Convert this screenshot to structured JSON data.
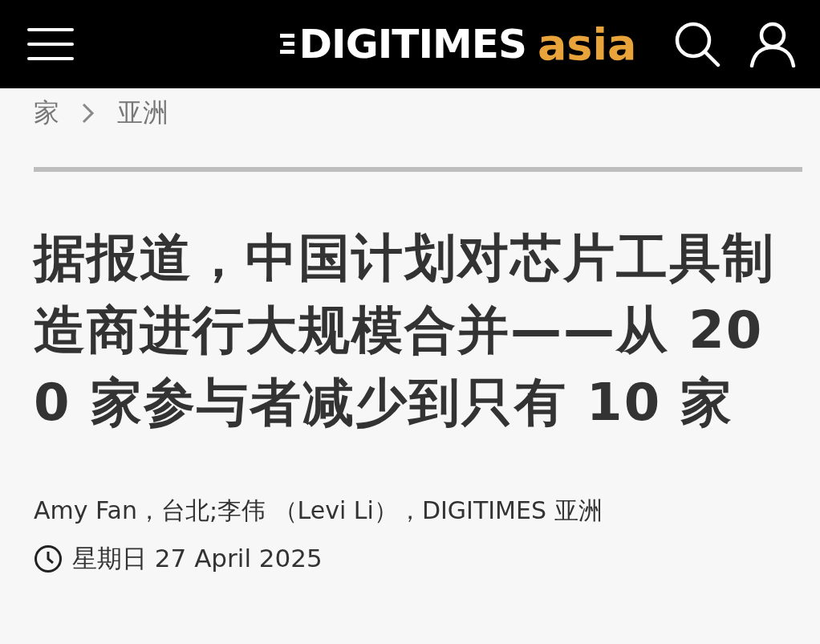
{
  "header": {
    "logo": {
      "name": "DIGITIMES",
      "suffix": "asia"
    }
  },
  "breadcrumb": [
    "家",
    "亚洲"
  ],
  "article": {
    "title": "据报道，中国计划对芯片工具制造商进行大规模合并——从 200 家参与者减少到只有 10 家",
    "byline": "Amy Fan，台北;李伟 （Levi Li），DIGITIMES 亚洲",
    "date": "星期日 27 April 2025"
  }
}
